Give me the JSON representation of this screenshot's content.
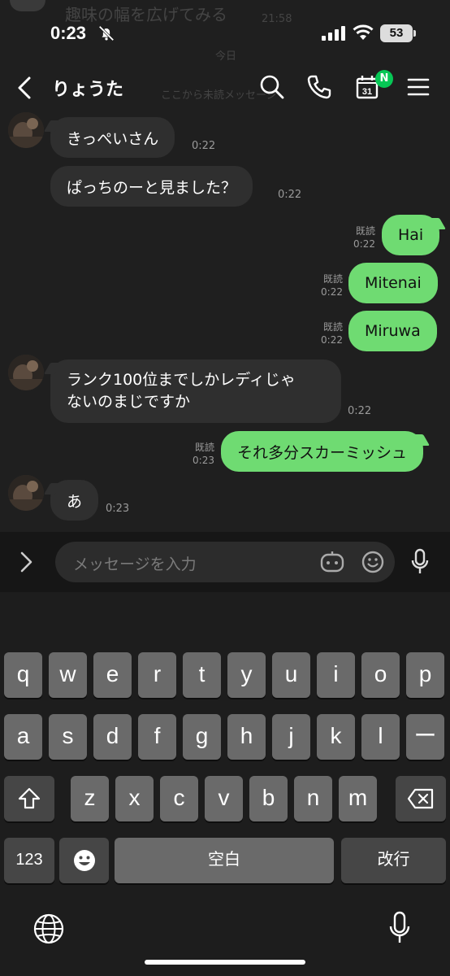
{
  "status_bar": {
    "time": "0:23",
    "battery": "53",
    "behind_text": "趣味の幅を広げてみる",
    "behind_time": "21:58"
  },
  "header": {
    "chat_name": "りょうた",
    "calendar_badge": "N",
    "calendar_day": "31",
    "behind_today": "今日",
    "behind_unread": "ここから未読メッセージ"
  },
  "messages": [
    {
      "dir": "in",
      "text": "きっぺいさん",
      "time": "0:22"
    },
    {
      "dir": "in",
      "text": "ぱっちのーと見ました？",
      "time": "0:22"
    },
    {
      "dir": "out",
      "text": "Hai",
      "read": "既読",
      "time": "0:22"
    },
    {
      "dir": "out",
      "text": "Mitenai",
      "read": "既読",
      "time": "0:22"
    },
    {
      "dir": "out",
      "text": "Miruwa",
      "read": "既読",
      "time": "0:22"
    },
    {
      "dir": "in",
      "text_line1": "ランク100位までしかレディじゃ",
      "text_line2": "ないのまじですか",
      "time": "0:22"
    },
    {
      "dir": "out",
      "text": "それ多分スカーミッシュ",
      "read": "既読",
      "time": "0:23"
    },
    {
      "dir": "in",
      "text": "あ",
      "time": "0:23"
    }
  ],
  "input": {
    "placeholder": "メッセージを入力"
  },
  "keyboard": {
    "row1": [
      "q",
      "w",
      "e",
      "r",
      "t",
      "y",
      "u",
      "i",
      "o",
      "p"
    ],
    "row2": [
      "a",
      "s",
      "d",
      "f",
      "g",
      "h",
      "j",
      "k",
      "l",
      "ー"
    ],
    "row3": [
      "z",
      "x",
      "c",
      "v",
      "b",
      "n",
      "m"
    ],
    "numbers_label": "123",
    "space_label": "空白",
    "return_label": "改行"
  },
  "colors": {
    "outgoing_bubble": "#6fdb72",
    "incoming_bubble": "#2f2f2f",
    "badge": "#06c755",
    "background": "#1f1f1f"
  }
}
